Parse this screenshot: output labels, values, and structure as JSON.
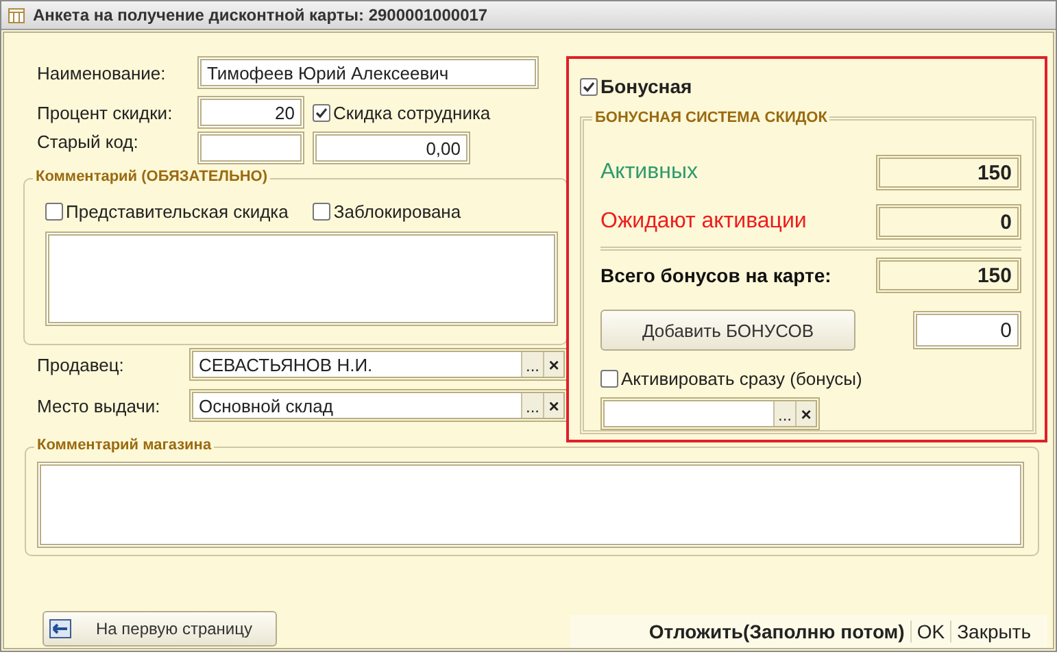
{
  "window": {
    "title": "Анкета на получение дисконтной карты: 2900001000017"
  },
  "name_field": {
    "label": "Наименование:",
    "value": "Тимофеев Юрий Алексеевич"
  },
  "discount": {
    "label": "Процент скидки:",
    "value": "20",
    "employee": {
      "label": "Скидка сотрудника",
      "checked": true
    }
  },
  "old_code": {
    "label": "Старый код:",
    "value": "0,00"
  },
  "comment_group": {
    "title": "Комментарий (ОБЯЗАТЕЛЬНО)",
    "checkboxes": [
      {
        "label": "Представительская скидка",
        "checked": false
      },
      {
        "label": "Заблокирована",
        "checked": false
      }
    ]
  },
  "seller": {
    "label": "Продавец:",
    "value": "СЕВАСТЬЯНОВ  Н.И.",
    "choose": "...",
    "clear": "×"
  },
  "issue_place": {
    "label": "Место выдачи:",
    "value": "Основной склад",
    "choose": "...",
    "clear": "×"
  },
  "bonus_panel": {
    "bonus": {
      "label": "Бонусная",
      "checked": true
    },
    "group_title": "БОНУСНАЯ СИСТЕМА СКИДОК",
    "rows": [
      {
        "label": "Активных",
        "value": "150",
        "color": "#2e9a6e"
      },
      {
        "label": "Ожидают активации",
        "value": "0",
        "color": "#ee1c1c"
      }
    ],
    "total": {
      "label": "Всего бонусов на карте:",
      "value": "150"
    },
    "add_button": "Добавить БОНУСОВ",
    "add_value": "0",
    "activate": {
      "label": "Активировать сразу (бонусы)",
      "checked": false
    },
    "choose": "...",
    "clear": "×"
  },
  "store_comment": {
    "title": "Комментарий магазина"
  },
  "footer": {
    "back_button": "На первую страницу",
    "actions": [
      {
        "label": "Отложить(Заполню потом)",
        "kind": "bold"
      },
      {
        "label": "OK",
        "kind": "plain"
      },
      {
        "label": "Закрыть",
        "kind": "plain"
      }
    ]
  }
}
